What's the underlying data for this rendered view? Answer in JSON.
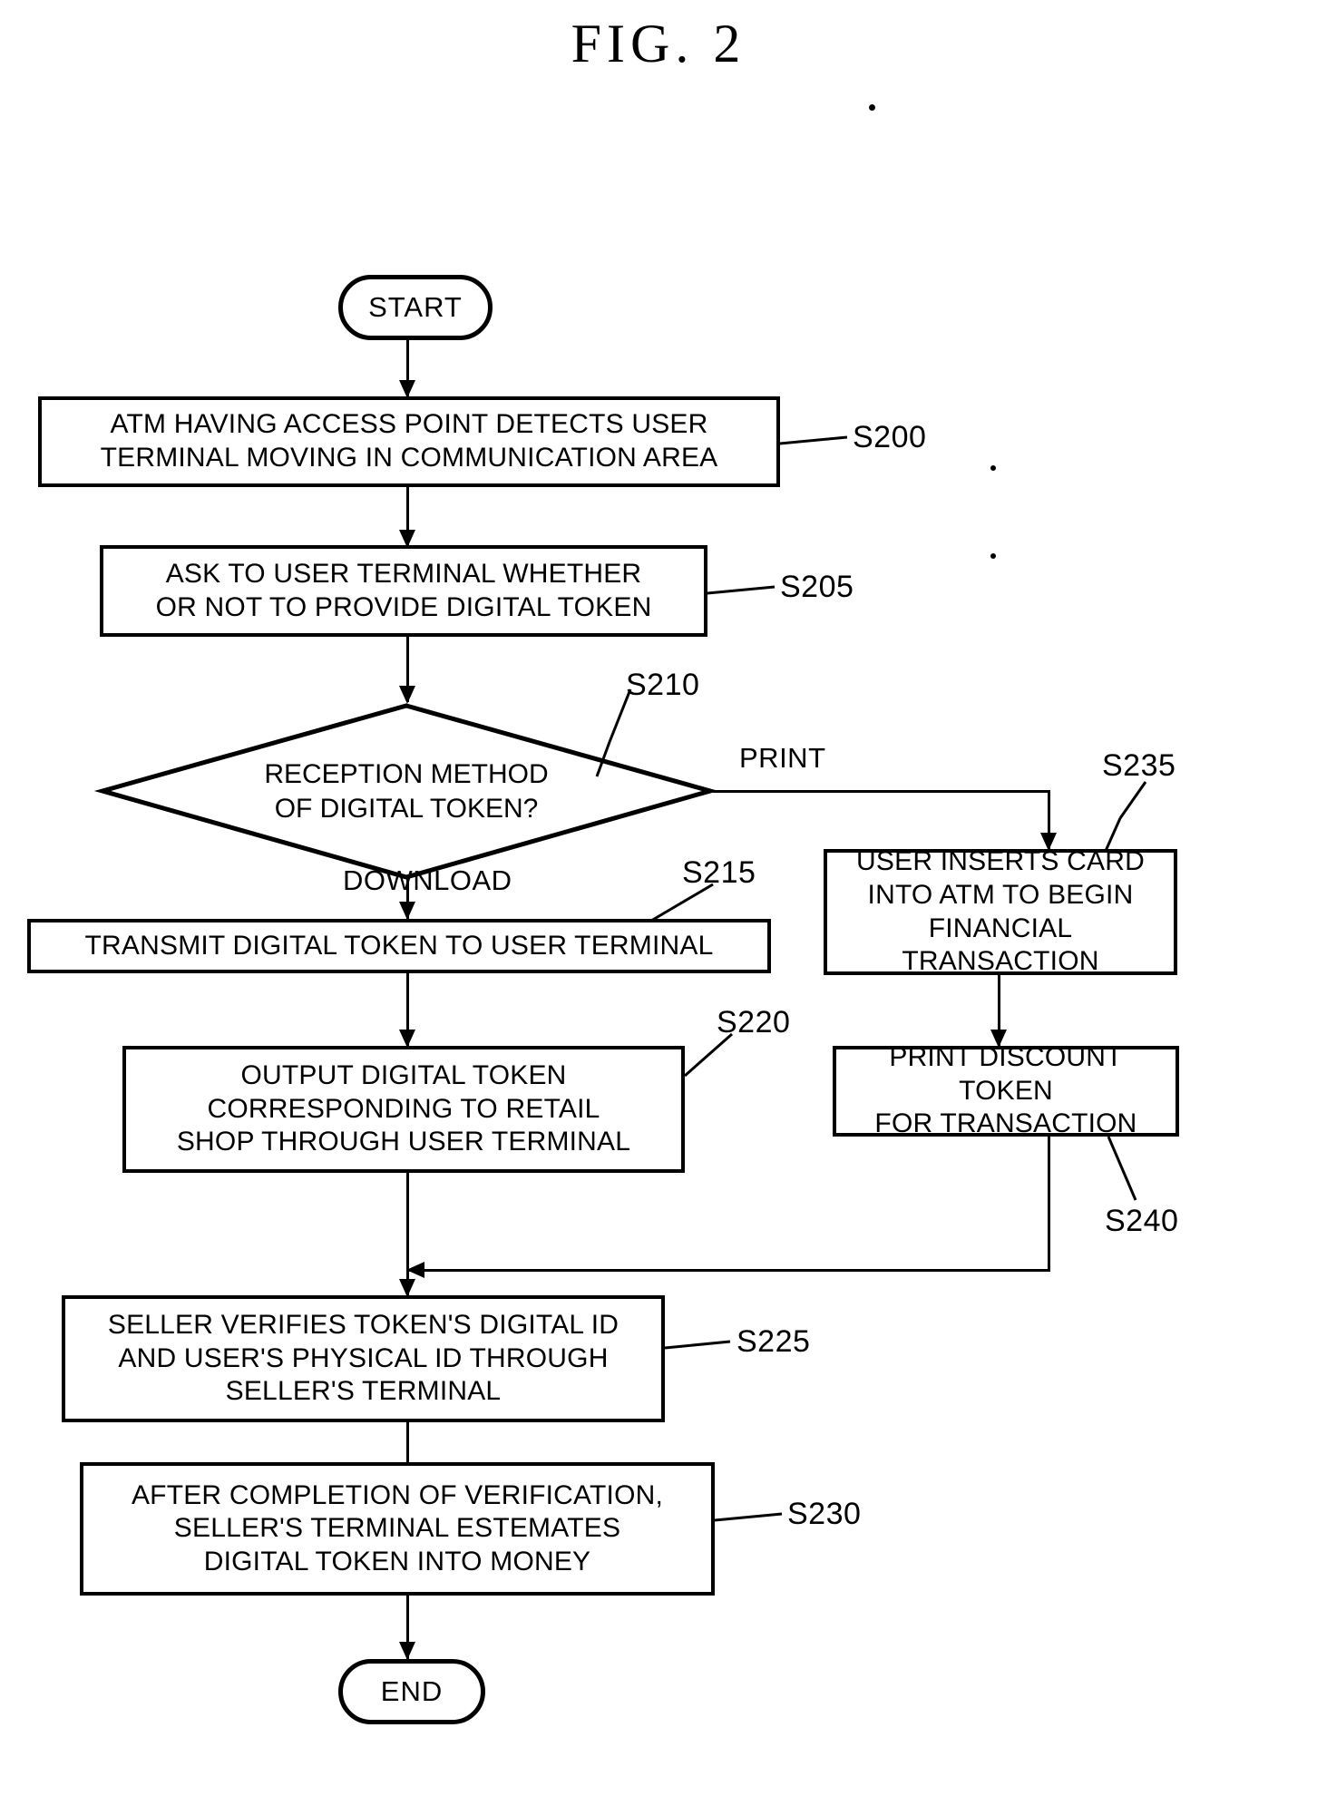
{
  "figure": {
    "title": "FIG.  2"
  },
  "nodes": {
    "start": {
      "label": "START"
    },
    "s200": {
      "text": "ATM HAVING ACCESS POINT DETECTS USER\nTERMINAL MOVING IN COMMUNICATION AREA",
      "ref": "S200"
    },
    "s205": {
      "text": "ASK TO USER TERMINAL WHETHER\nOR NOT TO PROVIDE DIGITAL TOKEN",
      "ref": "S205"
    },
    "s210": {
      "text": "RECEPTION METHOD\nOF DIGITAL TOKEN?",
      "ref": "S210",
      "line1": "RECEPTION METHOD",
      "line2": "OF DIGITAL TOKEN?"
    },
    "s215": {
      "text": "TRANSMIT DIGITAL TOKEN TO USER TERMINAL",
      "ref": "S215"
    },
    "s220": {
      "text": "OUTPUT DIGITAL TOKEN\nCORRESPONDING TO RETAIL\nSHOP THROUGH USER TERMINAL",
      "ref": "S220"
    },
    "s225": {
      "text": "SELLER VERIFIES TOKEN'S DIGITAL ID\nAND USER'S PHYSICAL ID THROUGH\nSELLER'S TERMINAL",
      "ref": "S225"
    },
    "s230": {
      "text": "AFTER COMPLETION OF VERIFICATION,\nSELLER'S TERMINAL ESTEMATES\nDIGITAL TOKEN INTO MONEY",
      "ref": "S230"
    },
    "s235": {
      "text": "USER INSERTS CARD\nINTO ATM TO BEGIN\nFINANCIAL TRANSACTION",
      "ref": "S235"
    },
    "s240": {
      "text": "PRINT DISCOUNT TOKEN\nFOR TRANSACTION",
      "ref": "S240"
    },
    "end": {
      "label": "END"
    }
  },
  "branches": {
    "print": "PRINT",
    "download": "DOWNLOAD"
  },
  "style": {
    "ink": "#000000",
    "paper": "#ffffff"
  }
}
